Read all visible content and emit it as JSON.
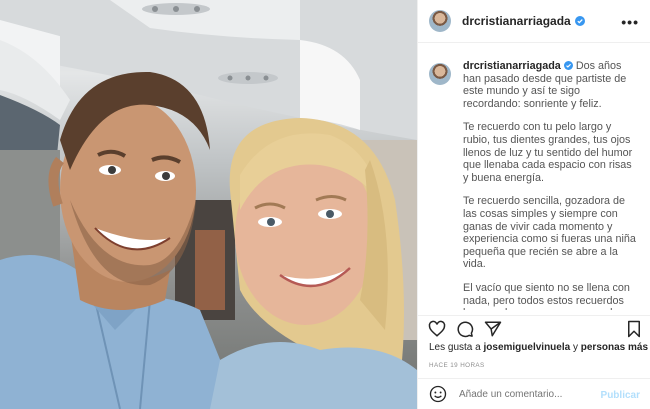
{
  "post": {
    "username": "drcristianarriagada",
    "more_icon": "more-horizontal-icon",
    "caption_paragraphs": [
      "Dos años han pasado desde que partiste de este mundo y así te sigo recordando: sonriente y feliz.",
      "Te recuerdo con tu pelo largo y rubio, tus dientes grandes, tus ojos llenos de luz y tu sentido del humor que llenaba cada espacio con risas y buena energía.",
      "Te recuerdo sencilla, gozadora de las cosas simples y siempre con ganas de vivir cada momento y experiencia como si fueras una niña pequeña que recién se abre a la vida.",
      "El vacío que siento no se llena con nada, pero todos estos recuerdos los guardo como una manera de"
    ],
    "likes_prefix": "Les gusta a",
    "likes_user": "josemiguelvinuela",
    "likes_middle": "y",
    "likes_others": "personas más",
    "time_ago": "HACE 19 HORAS",
    "comment_placeholder": "Añade un comentario...",
    "publish_label": "Publicar"
  },
  "colors": {
    "verified": "#3897f0",
    "publish_disabled": "#b2dffc"
  }
}
